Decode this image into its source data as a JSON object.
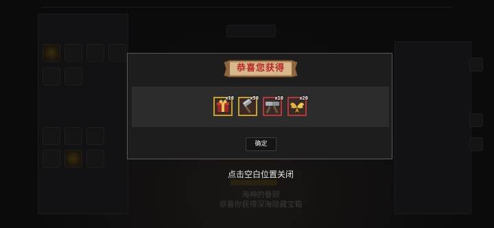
{
  "modal": {
    "title": "恭喜您获得",
    "rewards": [
      {
        "icon": "red-gift-box-icon",
        "quantity": "x10",
        "rarity": "yellow"
      },
      {
        "icon": "steel-hammer-icon",
        "quantity": "x50",
        "rarity": "yellow"
      },
      {
        "icon": "double-hammer-icon",
        "quantity": "x10",
        "rarity": "red"
      },
      {
        "icon": "golden-wings-icon",
        "quantity": "x20",
        "rarity": "red"
      }
    ],
    "confirm_label": "确定"
  },
  "close_hint": "点击空白位置关闭",
  "background": {
    "line1": "海神的眷顾",
    "line2": "恭喜你获得深海隐藏宝箱"
  },
  "colors": {
    "yellow_rarity": "#c7a233",
    "red_rarity": "#b23a3a",
    "banner_text": "#b8292a"
  }
}
